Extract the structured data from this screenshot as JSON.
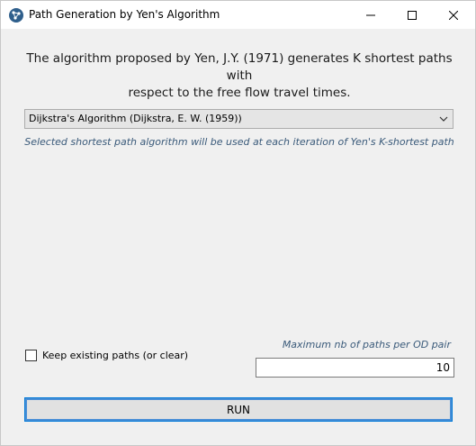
{
  "window": {
    "title": "Path Generation by Yen's Algorithm",
    "icon": "network-icon",
    "controls": [
      "minimize",
      "maximize",
      "close"
    ]
  },
  "main": {
    "description_line1": "The algorithm proposed by Yen, J.Y. (1971) generates K shortest paths with",
    "description_line2": "respect to the free flow travel times.",
    "algorithm_select": {
      "value": "Dijkstra's Algorithm (Dijkstra, E. W. (1959))"
    },
    "hint": "Selected shortest path algorithm will be used at each iteration of Yen's K-shortest path",
    "keep_paths": {
      "label": "Keep existing paths (or clear)",
      "checked": false
    },
    "max_paths": {
      "label": "Maximum nb of paths per OD pair",
      "value": "10"
    },
    "run_label": "RUN"
  },
  "colors": {
    "hint_text": "#3a5a7a",
    "focus_border": "#0078d7",
    "background": "#f0f0f0"
  }
}
